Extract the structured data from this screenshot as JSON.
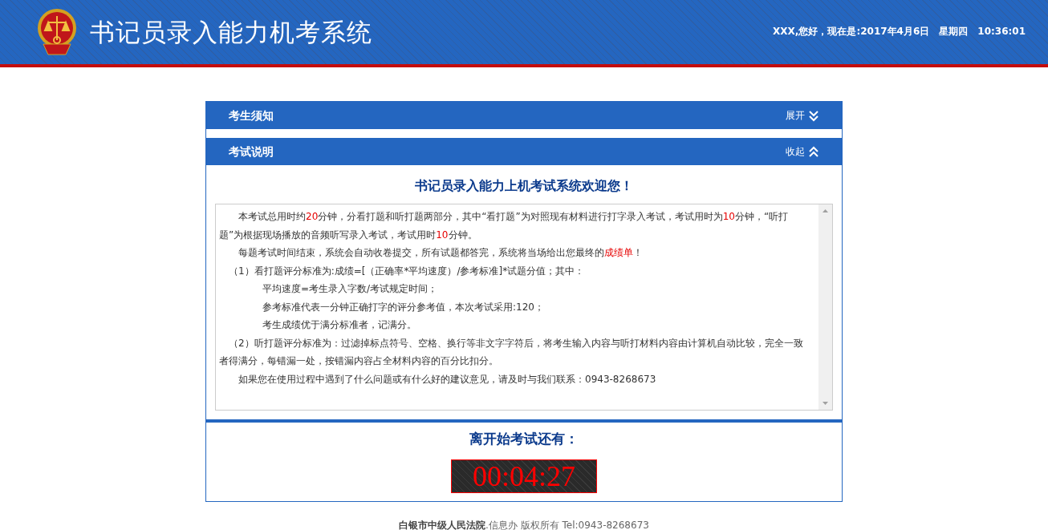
{
  "header": {
    "title": "书记员录入能力机考系统",
    "greeting": "XXX,您好，现在是:2017年4月6日　星期四　10:36:01"
  },
  "sections": [
    {
      "title": "考生须知",
      "toggle_label": "展开",
      "expanded": false
    },
    {
      "title": "考试说明",
      "toggle_label": "收起",
      "expanded": true,
      "heading": "书记员录入能力上机考试系统欢迎您！",
      "paragraphs": [
        {
          "kind": "para",
          "segments": [
            {
              "text": "本考试总用时约",
              "highlight": false
            },
            {
              "text": "20",
              "highlight": true
            },
            {
              "text": "分钟，分看打题和听打题两部分，其中“看打题”为对照现有材料进行打字录入考试，考试用时为",
              "highlight": false
            },
            {
              "text": "10",
              "highlight": true
            },
            {
              "text": "分钟，“听打题”为根据现场播放的音频听写录入考试，考试用时",
              "highlight": false
            },
            {
              "text": "10",
              "highlight": true
            },
            {
              "text": "分钟。",
              "highlight": false
            }
          ]
        },
        {
          "kind": "para",
          "segments": [
            {
              "text": "每题考试时间结束，系统会自动收卷提交，所有试题都答完，系统将当场给出您最终的",
              "highlight": false
            },
            {
              "text": "成绩单",
              "highlight": true
            },
            {
              "text": "！",
              "highlight": false
            }
          ]
        },
        {
          "kind": "item",
          "segments": [
            {
              "text": "（1）看打题评分标准为:成绩=[（正确率*平均速度）/参考标准]*试题分值；其中：",
              "highlight": false
            }
          ]
        },
        {
          "kind": "sub",
          "segments": [
            {
              "text": "平均速度=考生录入字数/考试规定时间；",
              "highlight": false
            }
          ]
        },
        {
          "kind": "sub",
          "segments": [
            {
              "text": "参考标准代表一分钟正确打字的评分参考值，本次考试采用:120；",
              "highlight": false
            }
          ]
        },
        {
          "kind": "sub",
          "segments": [
            {
              "text": "考生成绩优于满分标准者，记满分。",
              "highlight": false
            }
          ]
        },
        {
          "kind": "item",
          "segments": [
            {
              "text": "（2）听打题评分标准为：过滤掉标点符号、空格、换行等非文字字符后，将考生输入内容与听打材料内容由计算机自动比较，完全一致者得满分，每错漏一处，按错漏内容占全材料内容的百分比扣分。",
              "highlight": false
            }
          ]
        },
        {
          "kind": "para",
          "segments": [
            {
              "text": "如果您在使用过程中遇到了什么问题或有什么好的建议意见，请及时与我们联系：0943-8268673",
              "highlight": false
            }
          ]
        }
      ]
    }
  ],
  "countdown": {
    "label": "离开始考试还有：",
    "time": "00:04:27"
  },
  "footer": "**白银市中级人民法院**.信息办  版权所有 Tel:0943-8268673"
}
